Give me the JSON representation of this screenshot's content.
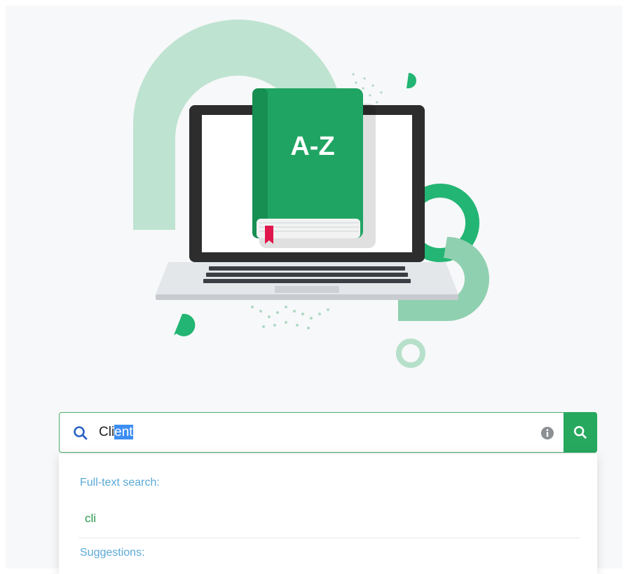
{
  "illustration": {
    "book_label": "A-Z"
  },
  "search": {
    "value_plain": "Cli",
    "value_selected": "ent"
  },
  "dropdown": {
    "fulltext_heading": "Full-text search:",
    "fulltext_item": "cli",
    "suggestions_heading": "Suggestions:"
  },
  "colors": {
    "accent_green": "#27a85f",
    "heading_blue": "#5aa9d6",
    "selection_blue": "#3c8ef2"
  }
}
